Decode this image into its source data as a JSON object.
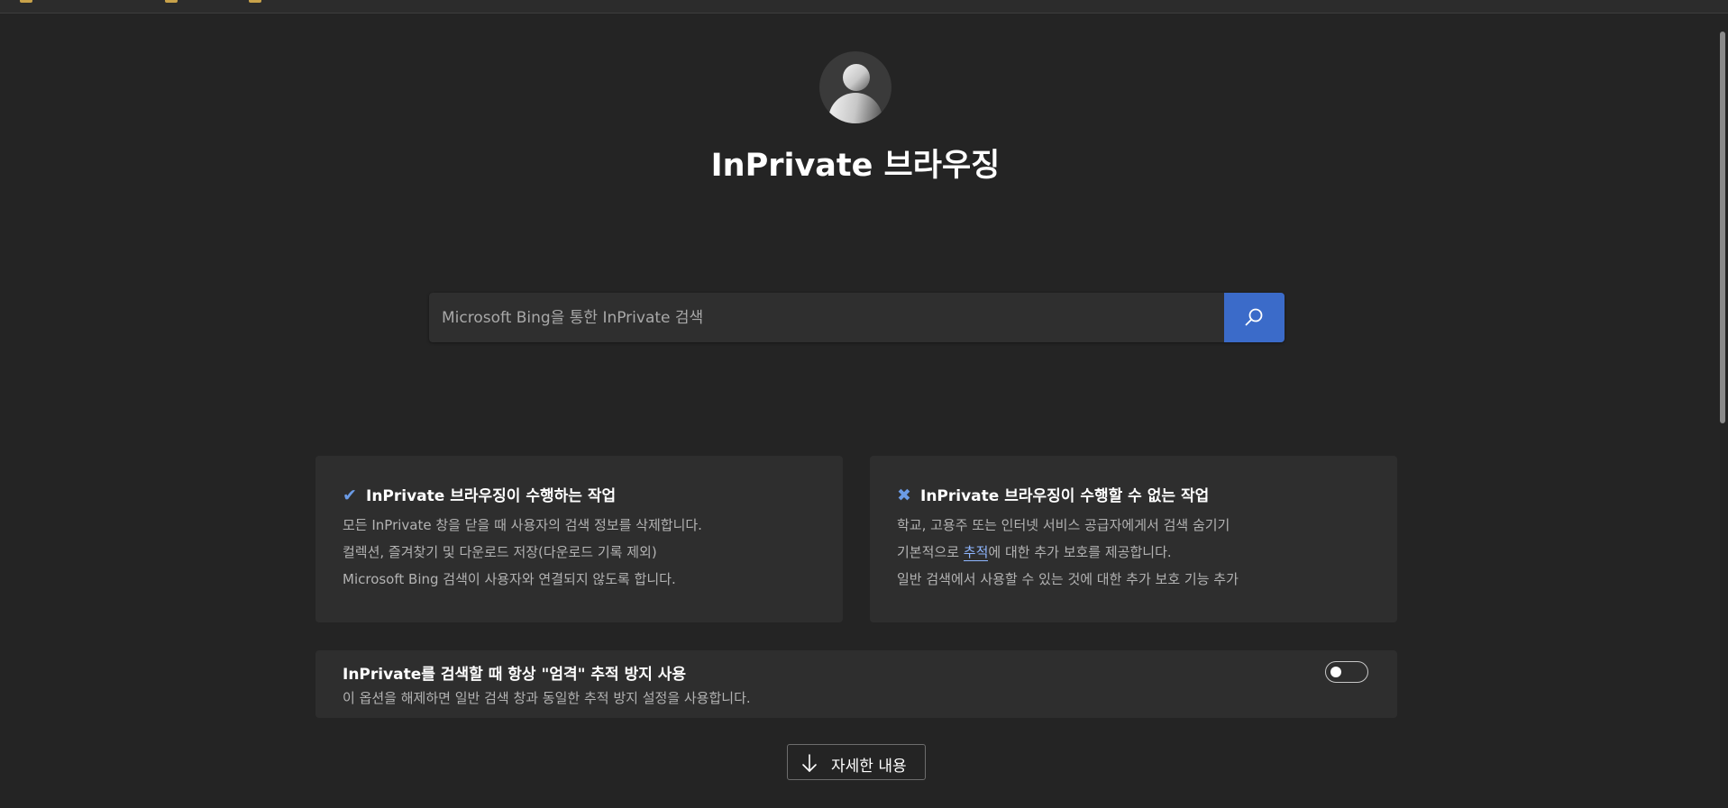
{
  "header": {
    "title": "InPrivate 브라우징"
  },
  "search": {
    "placeholder": "Microsoft Bing을 통한 InPrivate 검색"
  },
  "cards": [
    {
      "title": "InPrivate 브라우징이 수행하는 작업",
      "mark_icon": "checkmark-icon",
      "lines": [
        "모든 InPrivate 창을 닫을 때 사용자의 검색 정보를 삭제합니다.",
        "컬렉션, 즐겨찾기 및 다운로드 저장(다운로드 기록 제외)",
        "Microsoft Bing 검색이 사용자와 연결되지 않도록 합니다."
      ]
    },
    {
      "title": "InPrivate 브라우징이 수행할 수 없는 작업",
      "mark_icon": "x-icon",
      "lines": [
        "학교, 고용주 또는 인터넷 서비스 공급자에게서 검색 숨기기",
        "기본적으로 ",
        "일반 검색에서 사용할 수 있는 것에 대한 추가 보호 기능 추가"
      ],
      "link": "추적",
      "line2_suffix": "에 대한 추가 보호를 제공합니다."
    }
  ],
  "setting": {
    "title": "InPrivate를 검색할 때 항상 \"엄격\" 추적 방지 사용",
    "description": "이 옵션을 해제하면 일반 검색 창과 동일한 추적 방지 설정을 사용합니다.",
    "enabled": false
  },
  "more_button": {
    "label": "자세한 내용"
  },
  "colors": {
    "background": "#242424",
    "card": "#2e2e2e",
    "accent": "#3b6bc9"
  }
}
